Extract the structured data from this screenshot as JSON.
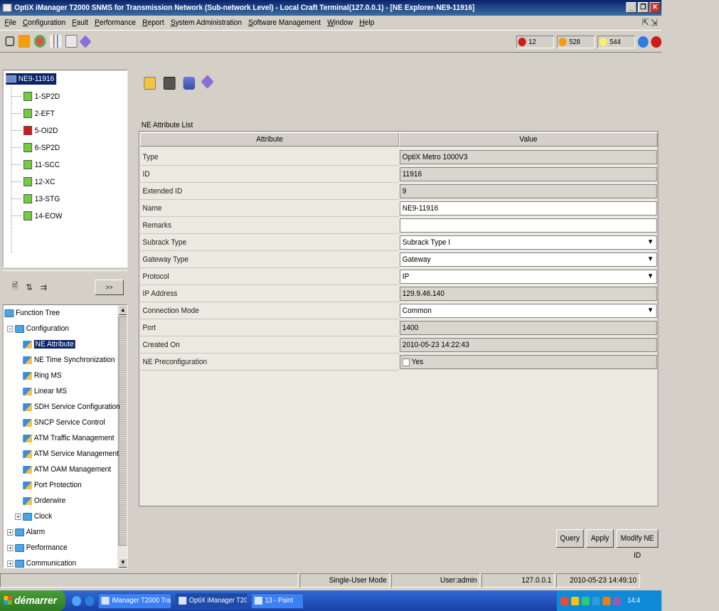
{
  "window": {
    "title": "OptiX iManager T2000 SNMS for Transmission Network (Sub-network Level) - Local Craft Terminal(127.0.0.1) - [NE Explorer-NE9-11916]"
  },
  "menu": [
    "File",
    "Configuration",
    "Fault",
    "Performance",
    "Report",
    "System Administration",
    "Software Management",
    "Window",
    "Help"
  ],
  "alarms": [
    {
      "count": "12",
      "color": "#d11a1a"
    },
    {
      "count": "528",
      "color": "#f39c12"
    },
    {
      "count": "544",
      "color": "#f7f06b"
    }
  ],
  "ne_tree": {
    "root": "NE9-11916",
    "boards": [
      {
        "label": "1-SP2D",
        "color": "#6fcf3b"
      },
      {
        "label": "2-EFT",
        "color": "#6fcf3b"
      },
      {
        "label": "5-OI2D",
        "color": "#d11a1a"
      },
      {
        "label": "6-SP2D",
        "color": "#6fcf3b"
      },
      {
        "label": "11-SCC",
        "color": "#6fcf3b"
      },
      {
        "label": "12-XC",
        "color": "#6fcf3b"
      },
      {
        "label": "13-STG",
        "color": "#6fcf3b"
      },
      {
        "label": "14-EOW",
        "color": "#6fcf3b"
      }
    ]
  },
  "function_tree": {
    "more_label": ">>",
    "root": "Function Tree",
    "config": "Configuration",
    "items": [
      "NE Attribute",
      "NE Time Synchronization",
      "Ring MS",
      "Linear MS",
      "SDH Service Configuration",
      "SNCP Service Control",
      "ATM Traffic Management",
      "ATM Service Management",
      "ATM OAM Management",
      "Port Protection",
      "Orderwire"
    ],
    "clock": "Clock",
    "groups": [
      "Alarm",
      "Performance",
      "Communication"
    ]
  },
  "main": {
    "list_title": "NE Attribute List",
    "col_attr": "Attribute",
    "col_val": "Value",
    "rows": [
      {
        "attr": "Type",
        "val": "OptiX Metro 1000V3"
      },
      {
        "attr": "ID",
        "val": "11916"
      },
      {
        "attr": "Extended ID",
        "val": "9"
      },
      {
        "attr": "Name",
        "val": "NE9-11916"
      },
      {
        "attr": "Remarks",
        "val": ""
      },
      {
        "attr": "Subrack Type",
        "val": "Subrack Type I"
      },
      {
        "attr": "Gateway Type",
        "val": "Gateway"
      },
      {
        "attr": "Protocol",
        "val": "IP"
      },
      {
        "attr": "IP Address",
        "val": "129.9.46.140"
      },
      {
        "attr": "Connection Mode",
        "val": "Common"
      },
      {
        "attr": "Port",
        "val": "1400"
      },
      {
        "attr": "Created On",
        "val": "2010-05-23 14:22:43"
      },
      {
        "attr": "NE Preconfiguration",
        "val": "Yes"
      }
    ],
    "buttons": {
      "query": "Query",
      "apply": "Apply",
      "modify": "Modify NE ID"
    }
  },
  "status": {
    "mode": "Single-User Mode",
    "user": "User:admin",
    "ip": "127.0.0.1",
    "time": "2010-05-23 14:49:10"
  },
  "taskbar": {
    "start": "démarrer",
    "tasks": [
      "iManager T2000 Tran...",
      "OptiX iManager T200...",
      "13 - Paint"
    ],
    "clock": "14:4"
  }
}
